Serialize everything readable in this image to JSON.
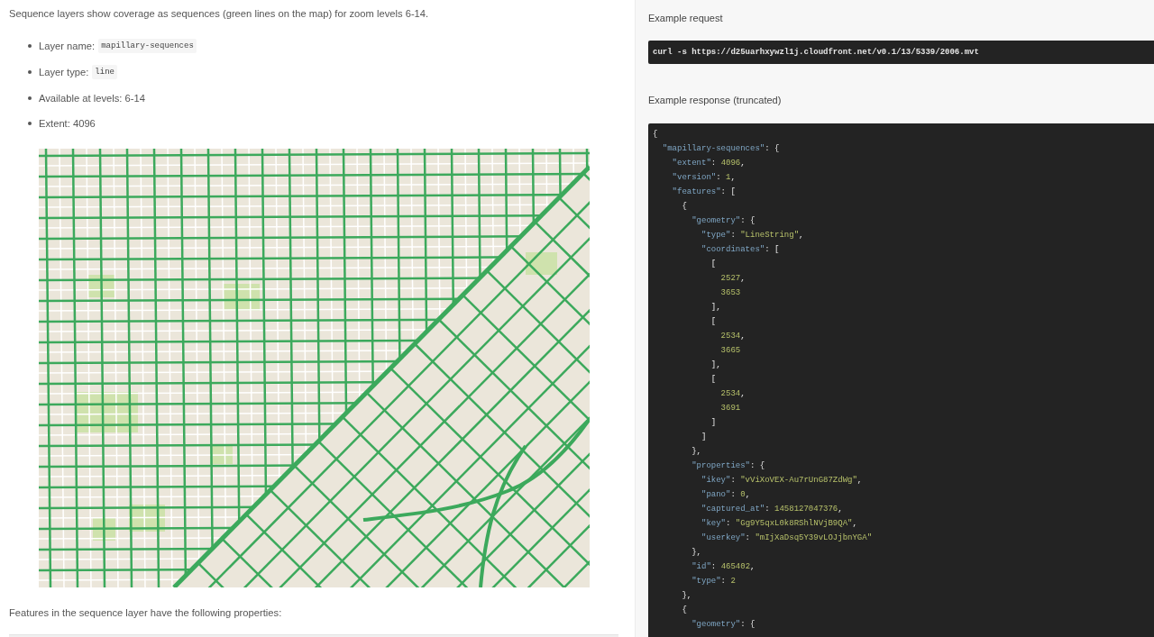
{
  "intro": "Sequence layers show coverage as sequences (green lines on the map) for zoom levels 6-14.",
  "layer_facts": [
    {
      "label": "Layer name:",
      "code": "mapillary-sequences"
    },
    {
      "label": "Layer type:",
      "code": "line"
    },
    {
      "label": "Available at levels: 6-14"
    },
    {
      "label": "Extent: 4096"
    }
  ],
  "features_note": "Features in the sequence layer have the following properties:",
  "example_request": {
    "title": "Example request",
    "code": "curl -s https://d25uarhxywzl1j.cloudfront.net/v0.1/13/5339/2006.mvt"
  },
  "example_response": {
    "title": "Example response (truncated)",
    "lines": [
      {
        "tokens": [
          {
            "kind": "punct",
            "text": "{"
          }
        ],
        "children": [
          {
            "tokens": [
              {
                "kind": "key",
                "text": "\"mapillary-sequences\""
              },
              {
                "kind": "punct",
                "text": ": {"
              }
            ],
            "children": [
              {
                "tokens": [
                  {
                    "kind": "key",
                    "text": "\"extent\""
                  },
                  {
                    "kind": "punct",
                    "text": ": "
                  },
                  {
                    "kind": "value",
                    "text": "4096"
                  },
                  {
                    "kind": "punct",
                    "text": ","
                  }
                ]
              },
              {
                "tokens": [
                  {
                    "kind": "key",
                    "text": "\"version\""
                  },
                  {
                    "kind": "punct",
                    "text": ": "
                  },
                  {
                    "kind": "value",
                    "text": "1"
                  },
                  {
                    "kind": "punct",
                    "text": ","
                  }
                ]
              },
              {
                "tokens": [
                  {
                    "kind": "key",
                    "text": "\"features\""
                  },
                  {
                    "kind": "punct",
                    "text": ": ["
                  }
                ],
                "children": [
                  {
                    "tokens": [
                      {
                        "kind": "punct",
                        "text": "{"
                      }
                    ],
                    "children": [
                      {
                        "tokens": [
                          {
                            "kind": "key",
                            "text": "\"geometry\""
                          },
                          {
                            "kind": "punct",
                            "text": ": {"
                          }
                        ],
                        "children": [
                          {
                            "tokens": [
                              {
                                "kind": "key",
                                "text": "\"type\""
                              },
                              {
                                "kind": "punct",
                                "text": ": "
                              },
                              {
                                "kind": "value",
                                "text": "\"LineString\""
                              },
                              {
                                "kind": "punct",
                                "text": ","
                              }
                            ]
                          },
                          {
                            "tokens": [
                              {
                                "kind": "key",
                                "text": "\"coordinates\""
                              },
                              {
                                "kind": "punct",
                                "text": ": ["
                              }
                            ],
                            "children": [
                              {
                                "tokens": [
                                  {
                                    "kind": "punct",
                                    "text": "["
                                  }
                                ],
                                "children": [
                                  {
                                    "tokens": [
                                      {
                                        "kind": "value",
                                        "text": "2527"
                                      },
                                      {
                                        "kind": "punct",
                                        "text": ","
                                      }
                                    ]
                                  },
                                  {
                                    "tokens": [
                                      {
                                        "kind": "value",
                                        "text": "3653"
                                      }
                                    ]
                                  }
                                ]
                              },
                              {
                                "tokens": [
                                  {
                                    "kind": "punct",
                                    "text": "],"
                                  }
                                ]
                              },
                              {
                                "tokens": [
                                  {
                                    "kind": "punct",
                                    "text": "["
                                  }
                                ],
                                "children": [
                                  {
                                    "tokens": [
                                      {
                                        "kind": "value",
                                        "text": "2534"
                                      },
                                      {
                                        "kind": "punct",
                                        "text": ","
                                      }
                                    ]
                                  },
                                  {
                                    "tokens": [
                                      {
                                        "kind": "value",
                                        "text": "3665"
                                      }
                                    ]
                                  }
                                ]
                              },
                              {
                                "tokens": [
                                  {
                                    "kind": "punct",
                                    "text": "],"
                                  }
                                ]
                              },
                              {
                                "tokens": [
                                  {
                                    "kind": "punct",
                                    "text": "["
                                  }
                                ],
                                "children": [
                                  {
                                    "tokens": [
                                      {
                                        "kind": "value",
                                        "text": "2534"
                                      },
                                      {
                                        "kind": "punct",
                                        "text": ","
                                      }
                                    ]
                                  },
                                  {
                                    "tokens": [
                                      {
                                        "kind": "value",
                                        "text": "3691"
                                      }
                                    ]
                                  }
                                ]
                              },
                              {
                                "tokens": [
                                  {
                                    "kind": "punct",
                                    "text": "]"
                                  }
                                ]
                              }
                            ]
                          },
                          {
                            "tokens": [
                              {
                                "kind": "punct",
                                "text": "]"
                              }
                            ]
                          }
                        ]
                      },
                      {
                        "tokens": [
                          {
                            "kind": "punct",
                            "text": "},"
                          }
                        ]
                      },
                      {
                        "tokens": [
                          {
                            "kind": "key",
                            "text": "\"properties\""
                          },
                          {
                            "kind": "punct",
                            "text": ": {"
                          }
                        ],
                        "children": [
                          {
                            "tokens": [
                              {
                                "kind": "key",
                                "text": "\"ikey\""
                              },
                              {
                                "kind": "punct",
                                "text": ": "
                              },
                              {
                                "kind": "value",
                                "text": "\"vViXoVEX-Au7rUnG87ZdWg\""
                              },
                              {
                                "kind": "punct",
                                "text": ","
                              }
                            ]
                          },
                          {
                            "tokens": [
                              {
                                "kind": "key",
                                "text": "\"pano\""
                              },
                              {
                                "kind": "punct",
                                "text": ": "
                              },
                              {
                                "kind": "value",
                                "text": "0"
                              },
                              {
                                "kind": "punct",
                                "text": ","
                              }
                            ]
                          },
                          {
                            "tokens": [
                              {
                                "kind": "key",
                                "text": "\"captured_at\""
                              },
                              {
                                "kind": "punct",
                                "text": ": "
                              },
                              {
                                "kind": "value",
                                "text": "1458127047376"
                              },
                              {
                                "kind": "punct",
                                "text": ","
                              }
                            ]
                          },
                          {
                            "tokens": [
                              {
                                "kind": "key",
                                "text": "\"key\""
                              },
                              {
                                "kind": "punct",
                                "text": ": "
                              },
                              {
                                "kind": "value",
                                "text": "\"Gg9Y5qxL0k8RShlNVjB9QA\""
                              },
                              {
                                "kind": "punct",
                                "text": ","
                              }
                            ]
                          },
                          {
                            "tokens": [
                              {
                                "kind": "key",
                                "text": "\"userkey\""
                              },
                              {
                                "kind": "punct",
                                "text": ": "
                              },
                              {
                                "kind": "value",
                                "text": "\"mIjXaDsq5Y39vLOJjbnYGA\""
                              }
                            ]
                          }
                        ]
                      },
                      {
                        "tokens": [
                          {
                            "kind": "punct",
                            "text": "},"
                          }
                        ]
                      },
                      {
                        "tokens": [
                          {
                            "kind": "key",
                            "text": "\"id\""
                          },
                          {
                            "kind": "punct",
                            "text": ": "
                          },
                          {
                            "kind": "value",
                            "text": "465402"
                          },
                          {
                            "kind": "punct",
                            "text": ","
                          }
                        ]
                      },
                      {
                        "tokens": [
                          {
                            "kind": "key",
                            "text": "\"type\""
                          },
                          {
                            "kind": "punct",
                            "text": ": "
                          },
                          {
                            "kind": "value",
                            "text": "2"
                          }
                        ]
                      }
                    ]
                  },
                  {
                    "tokens": [
                      {
                        "kind": "punct",
                        "text": "},"
                      }
                    ]
                  },
                  {
                    "tokens": [
                      {
                        "kind": "punct",
                        "text": "{"
                      }
                    ],
                    "children": [
                      {
                        "tokens": [
                          {
                            "kind": "key",
                            "text": "\"geometry\""
                          },
                          {
                            "kind": "punct",
                            "text": ": {"
                          }
                        ]
                      }
                    ]
                  }
                ]
              }
            ]
          }
        ]
      }
    ]
  }
}
